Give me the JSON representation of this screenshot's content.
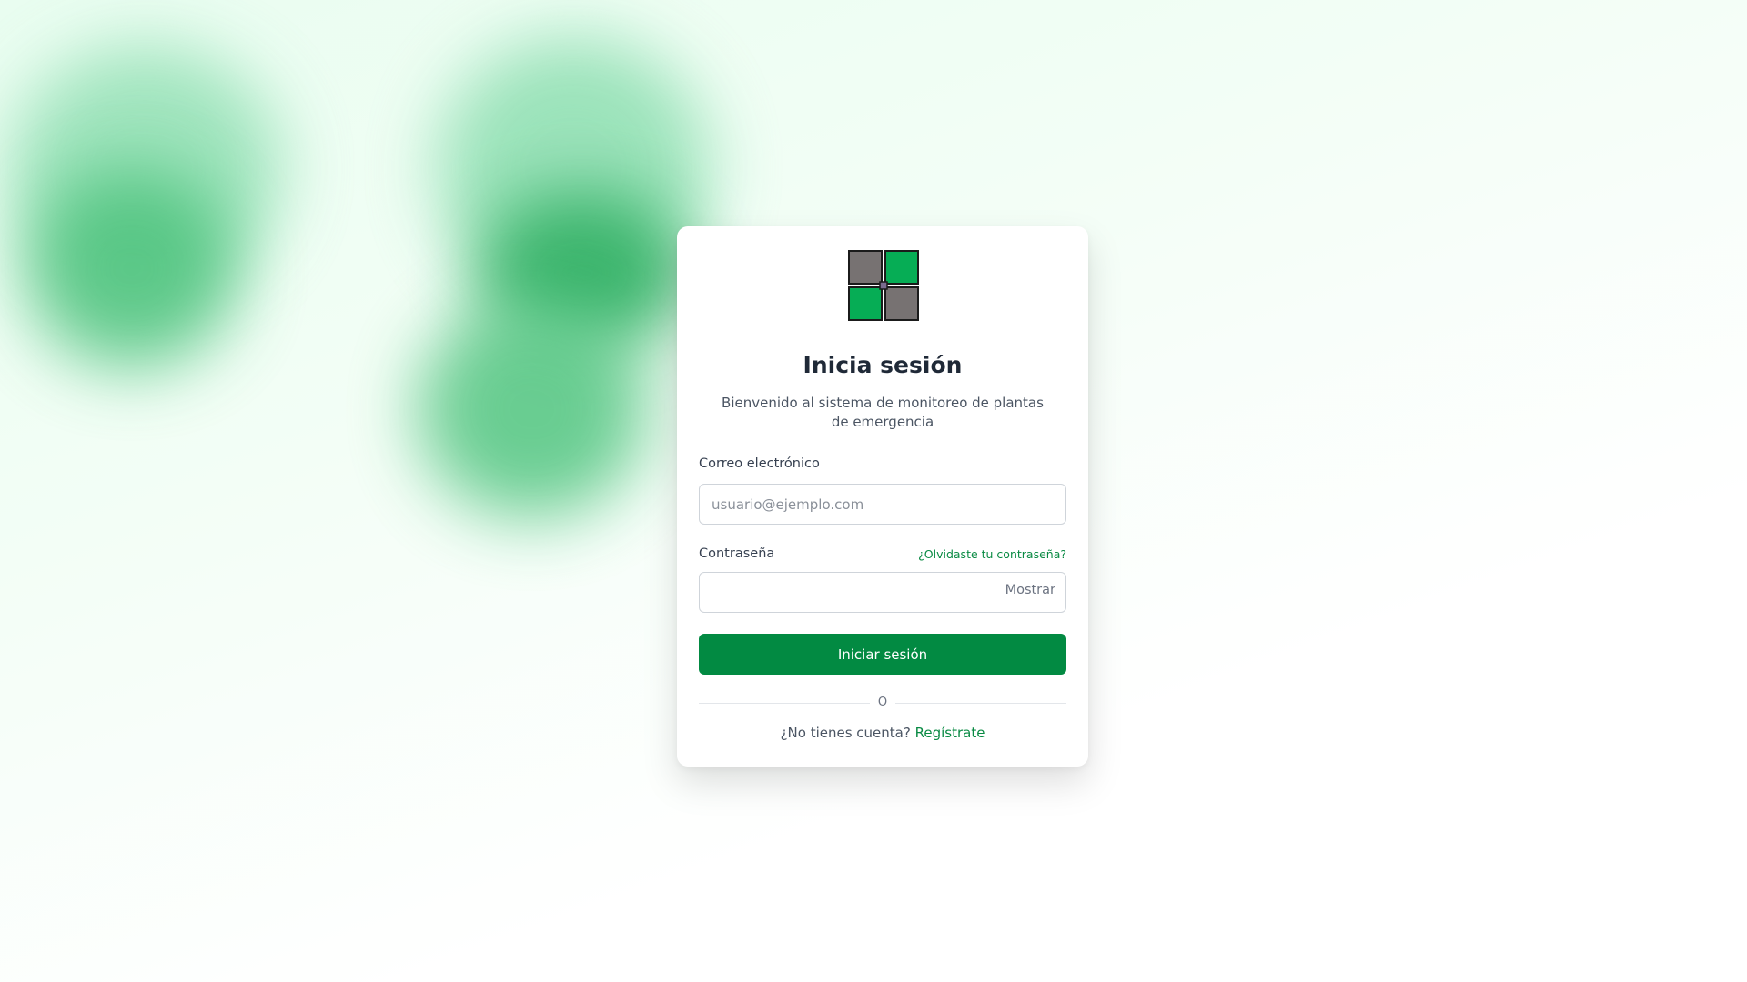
{
  "colors": {
    "brand_green": "#028a42",
    "link_green": "#098a43",
    "logo_green": "#06ad55",
    "logo_gray": "#777272"
  },
  "logo": {
    "icon": "four-squares-logo-icon"
  },
  "login": {
    "title": "Inicia sesión",
    "subtitle": "Bienvenido al sistema de monitoreo de plantas de emergencia",
    "email_label": "Correo electrónico",
    "email_placeholder": "usuario@ejemplo.com",
    "email_value": "",
    "password_label": "Contraseña",
    "password_value": "",
    "forgot_link": "¿Olvidaste tu contraseña?",
    "show_toggle": "Mostrar",
    "submit_label": "Iniciar sesión",
    "divider_text": "O",
    "no_account_text": "¿No tienes cuenta?",
    "signup_link": "Regístrate"
  }
}
